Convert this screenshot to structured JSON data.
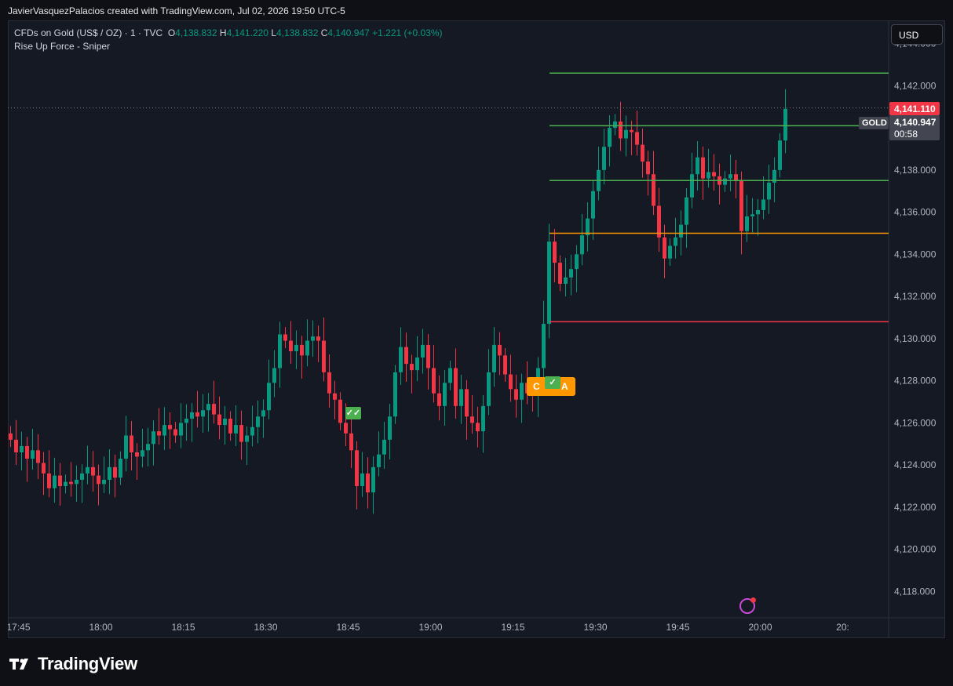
{
  "header": {
    "credit": "JavierVasquezPalacios created with TradingView.com, Jul 02, 2026 19:50 UTC-5"
  },
  "legend": {
    "symbol": "CFDs on Gold (US$ / OZ) · 1 · TVC",
    "o_label": "O",
    "o": "4,138.832",
    "h_label": "H",
    "h": "4,141.220",
    "l_label": "L",
    "l": "4,138.832",
    "c_label": "C",
    "c": "4,140.947",
    "change": "+1.221 (+0.03%)",
    "indicator": "Rise Up Force - Sniper"
  },
  "currency": "USD",
  "price_tags": {
    "last": "4,141.110",
    "current": "4,140.947",
    "countdown": "00:58",
    "symbol_tag": "GOLD"
  },
  "signals": {
    "orange_left": "C",
    "orange_right": "A",
    "check1": "✓✓",
    "check2": "✓"
  },
  "footer": {
    "brand": "TradingView"
  },
  "colors": {
    "up": "#089981",
    "down": "#f23645",
    "bg": "#151924",
    "tp": "#4caf50",
    "entry": "#ff9800",
    "sl": "#f23645"
  },
  "chart_data": {
    "type": "candlestick",
    "y_ticks": [
      "4,144.000",
      "4,142.000",
      "4,140.000",
      "4,138.000",
      "4,136.000",
      "4,134.000",
      "4,132.000",
      "4,130.000",
      "4,128.000",
      "4,126.000",
      "4,124.000",
      "4,122.000",
      "4,120.000",
      "4,118.000"
    ],
    "y_tick_values": [
      4144,
      4142,
      4140,
      4138,
      4136,
      4134,
      4132,
      4130,
      4128,
      4126,
      4124,
      4122,
      4120,
      4118
    ],
    "ylim": [
      4116.75,
      4145.1
    ],
    "x_ticks": [
      "17:45",
      "18:00",
      "18:15",
      "18:30",
      "18:45",
      "19:00",
      "19:15",
      "19:30",
      "19:45",
      "20:00",
      "20:"
    ],
    "x_tick_minutes": [
      1065,
      1080,
      1095,
      1110,
      1125,
      1140,
      1155,
      1170,
      1185,
      1200,
      1215
    ],
    "start_minute": 1063.5,
    "level_lines": [
      {
        "value": 4142.6,
        "role": "tp3"
      },
      {
        "value": 4140.1,
        "role": "tp2"
      },
      {
        "value": 4137.5,
        "role": "tp1"
      },
      {
        "value": 4135.0,
        "role": "entry"
      },
      {
        "value": 4130.8,
        "role": "stop"
      }
    ],
    "current_price": 4140.947,
    "closes": [
      4125.2,
      4124.6,
      4124.9,
      4124.3,
      4124.7,
      4124.1,
      4123.6,
      4122.9,
      4123.5,
      4123.0,
      4123.2,
      4123.1,
      4123.3,
      4123.6,
      4123.9,
      4123.5,
      4123.1,
      4123.3,
      4123.9,
      4123.4,
      4124.3,
      4125.4,
      4124.6,
      4124.4,
      4124.7,
      4125.0,
      4125.6,
      4125.4,
      4125.9,
      4125.7,
      4125.4,
      4126.0,
      4126.2,
      4126.5,
      4126.3,
      4126.6,
      4126.9,
      4126.4,
      4125.9,
      4126.2,
      4125.5,
      4125.9,
      4125.1,
      4125.4,
      4125.8,
      4126.3,
      4126.6,
      4127.9,
      4128.6,
      4130.2,
      4129.9,
      4129.4,
      4129.7,
      4129.2,
      4129.9,
      4130.1,
      4129.9,
      4128.4,
      4127.4,
      4127.1,
      4126.0,
      4125.5,
      4124.7,
      4123.0,
      4123.6,
      4122.7,
      4123.9,
      4124.5,
      4125.2,
      4126.3,
      4128.4,
      4129.6,
      4128.8,
      4128.5,
      4129.1,
      4129.7,
      4128.6,
      4127.4,
      4126.8,
      4127.9,
      4128.6,
      4126.8,
      4127.6,
      4126.3,
      4126.0,
      4125.6,
      4126.8,
      4128.4,
      4129.7,
      4129.2,
      4128.3,
      4127.6,
      4127.1,
      4127.9,
      4127.4,
      4127.3,
      4128.6,
      4130.7,
      4134.6,
      4133.6,
      4132.6,
      4132.9,
      4133.3,
      4134.0,
      4134.9,
      4135.7,
      4137.0,
      4138.0,
      4139.1,
      4140.0,
      4140.3,
      4139.5,
      4139.9,
      4139.8,
      4139.2,
      4138.4,
      4137.8,
      4136.3,
      4134.8,
      4133.8,
      4134.4,
      4134.8,
      4135.4,
      4136.7,
      4137.8,
      4138.6,
      4137.6,
      4137.9,
      4137.7,
      4137.3,
      4137.6,
      4137.8,
      4137.5,
      4135.1,
      4135.8,
      4135.9,
      4136.1,
      4136.6,
      4137.4,
      4138.0,
      4139.4,
      4140.9
    ]
  }
}
